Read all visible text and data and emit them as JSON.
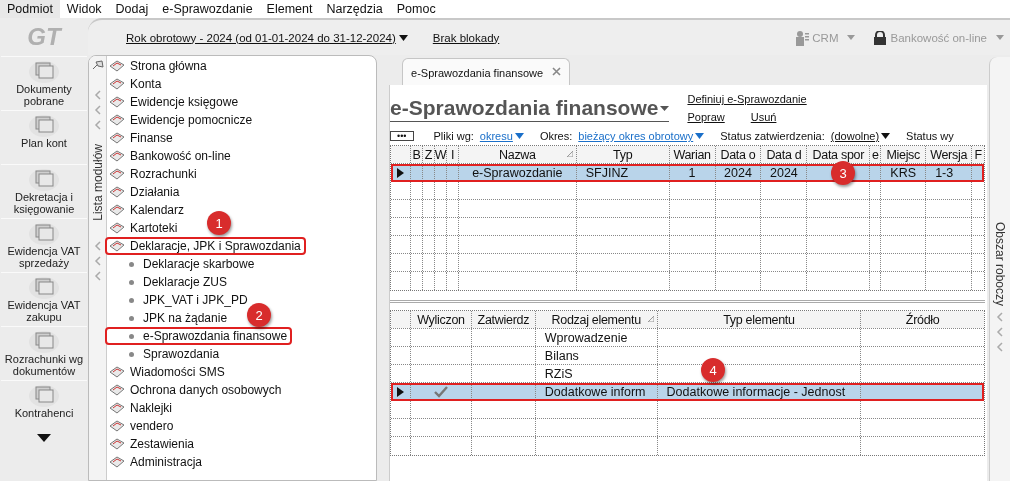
{
  "menu": [
    {
      "label": "Podmiot",
      "selected": true
    },
    {
      "label": "Widok",
      "selected": false
    },
    {
      "label": "Dodaj",
      "selected": false
    },
    {
      "label": "e-Sprawozdanie",
      "selected": false
    },
    {
      "label": "Element",
      "selected": false
    },
    {
      "label": "Narzędzia",
      "selected": false
    },
    {
      "label": "Pomoc",
      "selected": false
    }
  ],
  "logo": "GT",
  "top_bar": {
    "period": "Rok obrotowy - 2024  (od 01-01-2024 do 31-12-2024)",
    "lock": "Brak blokady",
    "crm": "CRM",
    "bank": "Bankowość on-line"
  },
  "left_toolbar": [
    "Dokumenty pobrane",
    "Plan kont",
    "Dekretacja i księgowanie",
    "Ewidencja VAT sprzedaży",
    "Ewidencja VAT zakupu",
    "Rozrachunki wg dokumentów",
    "Kontrahenci"
  ],
  "module_panel": {
    "title": "Lista modułów",
    "items": [
      {
        "label": "Strona główna",
        "highlighted": false
      },
      {
        "label": "Konta",
        "highlighted": false
      },
      {
        "label": "Ewidencje księgowe",
        "highlighted": false
      },
      {
        "label": "Ewidencje pomocnicze",
        "highlighted": false
      },
      {
        "label": "Finanse",
        "highlighted": false
      },
      {
        "label": "Bankowość on-line",
        "highlighted": false
      },
      {
        "label": "Rozrachunki",
        "highlighted": false
      },
      {
        "label": "Działania",
        "highlighted": false
      },
      {
        "label": "Kalendarz",
        "highlighted": false
      },
      {
        "label": "Kartoteki",
        "highlighted": false
      },
      {
        "label": "Deklaracje, JPK i Sprawozdania",
        "highlighted": true,
        "callout": "1",
        "children": [
          {
            "label": "Deklaracje skarbowe",
            "highlighted": false
          },
          {
            "label": "Deklaracje ZUS",
            "highlighted": false
          },
          {
            "label": "JPK_VAT i JPK_PD",
            "highlighted": false
          },
          {
            "label": "JPK na żądanie",
            "highlighted": false
          },
          {
            "label": "e-Sprawozdania finansowe",
            "highlighted": true,
            "callout": "2"
          },
          {
            "label": "Sprawozdania",
            "highlighted": false
          }
        ]
      },
      {
        "label": "Wiadomości SMS",
        "highlighted": false
      },
      {
        "label": "Ochrona danych osobowych",
        "highlighted": false
      },
      {
        "label": "Naklejki",
        "highlighted": false
      },
      {
        "label": "vendero",
        "highlighted": false
      },
      {
        "label": "Zestawienia",
        "highlighted": false
      },
      {
        "label": "Administracja",
        "highlighted": false
      }
    ]
  },
  "tab": {
    "label": "e-Sprawozdania finansowe"
  },
  "page": {
    "title": "e-Sprawozdania finansowe",
    "links": [
      "Definiuj e-Sprawozdanie",
      "Popraw",
      "Usuń"
    ]
  },
  "filters": {
    "more": "•••",
    "items": [
      {
        "label": "Pliki wg:",
        "value": "okresu",
        "kind": "blue"
      },
      {
        "label": "Okres:",
        "value": "bieżący okres obrotowy",
        "kind": "blue"
      },
      {
        "label": "Status zatwierdzenia:",
        "value": "(dowolne)",
        "kind": "plain"
      },
      {
        "label": "Status wy",
        "kind": "label"
      }
    ]
  },
  "reports_table": {
    "columns": [
      {
        "label": "B",
        "sorted": false
      },
      {
        "label": "Z",
        "sorted": false
      },
      {
        "label": "W",
        "sorted": false
      },
      {
        "label": "I",
        "sorted": false
      },
      {
        "label": "Nazwa",
        "sorted": true
      },
      {
        "label": "Typ",
        "sorted": false
      },
      {
        "label": "Warian",
        "sorted": false
      },
      {
        "label": "Data o",
        "sorted": false
      },
      {
        "label": "Data d",
        "sorted": false
      },
      {
        "label": "Data spor",
        "sorted": false
      },
      {
        "label": "e",
        "sorted": false
      },
      {
        "label": "Miejsc",
        "sorted": false
      },
      {
        "label": "Wersja",
        "sorted": false
      },
      {
        "label": "F",
        "sorted": false
      }
    ],
    "rows": [
      {
        "selected": true,
        "highlighted": true,
        "callout": "3",
        "cells": [
          null,
          null,
          null,
          null,
          "e-Sprawozdanie",
          "SFJINZ",
          "1",
          "2024",
          "2024",
          null,
          null,
          "KRS",
          "1-3",
          null
        ]
      }
    ]
  },
  "elements_table": {
    "columns": [
      {
        "label": "Wyliczon",
        "sorted": false
      },
      {
        "label": "Zatwierdz",
        "sorted": false
      },
      {
        "label": "Rodzaj elementu",
        "sorted": true
      },
      {
        "label": "Typ elementu",
        "sorted": false
      },
      {
        "label": "Źródło",
        "sorted": false
      }
    ],
    "rows": [
      {
        "selected": false,
        "highlighted": false,
        "checked": false,
        "cells": [
          null,
          null,
          "Wprowadzenie",
          null,
          null
        ]
      },
      {
        "selected": false,
        "highlighted": false,
        "checked": false,
        "cells": [
          null,
          null,
          "Bilans",
          null,
          null
        ]
      },
      {
        "selected": false,
        "highlighted": false,
        "checked": false,
        "cells": [
          null,
          null,
          "RZiS",
          null,
          null
        ]
      },
      {
        "selected": true,
        "highlighted": true,
        "checked": true,
        "callout": "4",
        "cells": [
          null,
          null,
          "Dodatkowe inform",
          "Dodatkowe informacje - Jednost",
          null
        ]
      }
    ]
  },
  "right_panel": {
    "title": "Obszar roboczy"
  }
}
